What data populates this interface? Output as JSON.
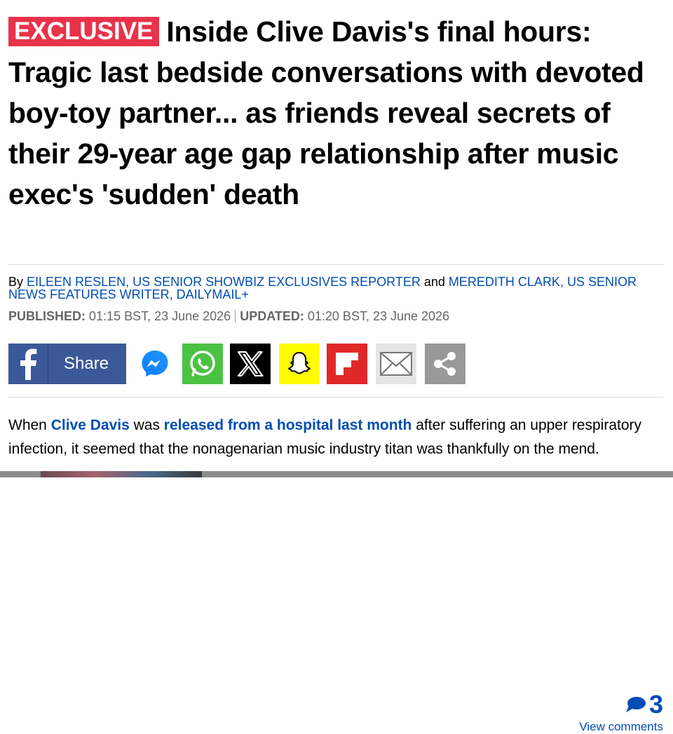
{
  "article": {
    "badge": "EXCLUSIVE",
    "headline": "Inside Clive Davis's final hours: Tragic last bedside conversations with devoted boy-toy partner... as friends reveal secrets of their 29-year age gap relationship after music exec's 'sudden' death",
    "byline": {
      "prefix": "By",
      "author1": "EILEEN RESLEN, US SENIOR SHOWBIZ EXCLUSIVES REPORTER",
      "joiner": "and",
      "author2": "MEREDITH CLARK, US SENIOR NEWS FEATURES WRITER, DAILYMAIL+"
    },
    "dates": {
      "published_label": "PUBLISHED:",
      "published_value": "01:15 BST, 23 June 2026",
      "updated_label": "UPDATED:",
      "updated_value": "01:20 BST, 23 June 2026"
    },
    "share": {
      "facebook_label": "Share",
      "icons": [
        "facebook-icon",
        "messenger-icon",
        "whatsapp-icon",
        "x-icon",
        "snapchat-icon",
        "flipboard-icon",
        "email-icon",
        "more-share-icon"
      ]
    },
    "comments": {
      "count": "3",
      "link": "View comments"
    },
    "body": {
      "p1_a": "When ",
      "link1": "Clive Davis",
      "p1_b": " was ",
      "link2": "released from a hospital last month",
      "p1_c": " after suffering an upper respiratory infection, it seemed that the nonagenarian music industry titan was thankfully on the mend."
    }
  },
  "colors": {
    "badge_bg": "#e8334a",
    "link": "#004db3",
    "facebook": "#3b5998",
    "whatsapp": "#4cc244",
    "snapchat": "#fffc00",
    "flipboard": "#e12828"
  }
}
